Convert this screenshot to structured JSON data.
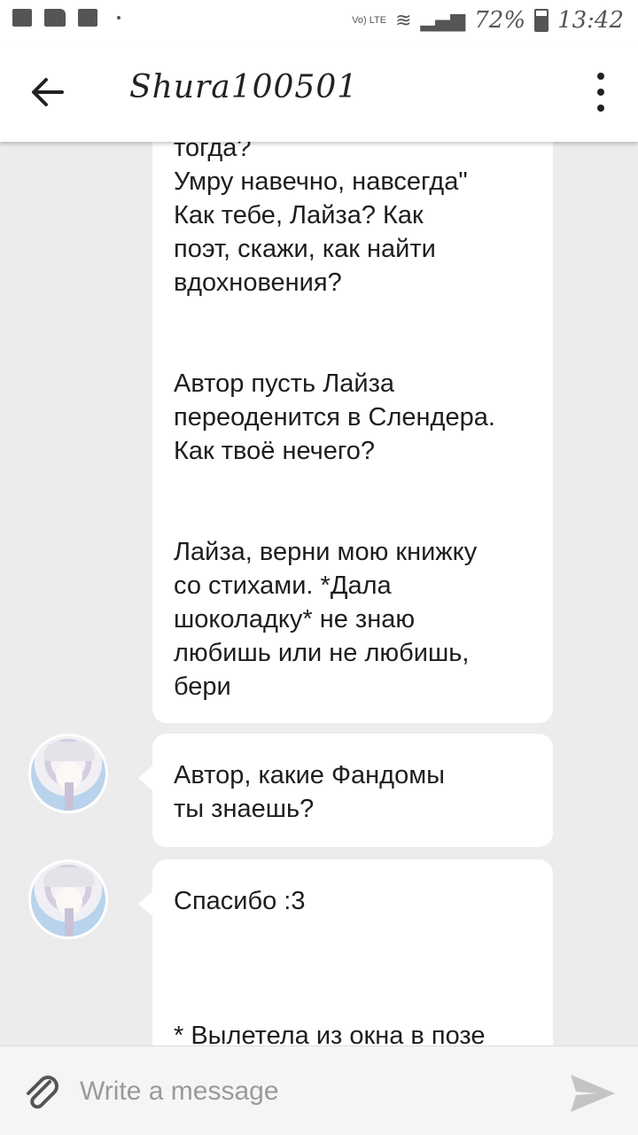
{
  "status_bar": {
    "signal_label": "Vo) LTE",
    "battery": "72%",
    "time": "13:42",
    "icons": [
      "image-icon",
      "folder-icon",
      "activity-icon",
      "sim-icon",
      "wifi-icon",
      "signal-icon",
      "battery-icon"
    ]
  },
  "header": {
    "title": "Shura100501",
    "back_icon": "arrow-left-icon",
    "menu_icon": "more-vertical-icon"
  },
  "messages": [
    {
      "text": "тогда?\nУмру навечно, навсегда\"\nКак тебе, Лайза? Как\nпоэт, скажи, как найти\nвдохновения?\n\n\nАвтор пусть Лайза\nпереоденится в Слендера.\nКак твоё нечего?\n\n\nЛайза, верни мою книжку\nсо стихами. *Дала\nшоколадку* не знаю\nлюбишь или не любишь,\nбери",
      "has_avatar": false
    },
    {
      "text": "Автор, какие Фандомы\nты знаешь?",
      "has_avatar": true
    },
    {
      "text": "Спасибо :3\n\n\n\n* Вылетела из окна в позе",
      "has_avatar": true
    }
  ],
  "composer": {
    "placeholder": "Write a message",
    "attach_icon": "paperclip-icon",
    "send_icon": "send-icon"
  },
  "colors": {
    "background": "#ececec",
    "bubble": "#ffffff",
    "text": "#1e1e1e",
    "placeholder": "#9a9a9a"
  }
}
